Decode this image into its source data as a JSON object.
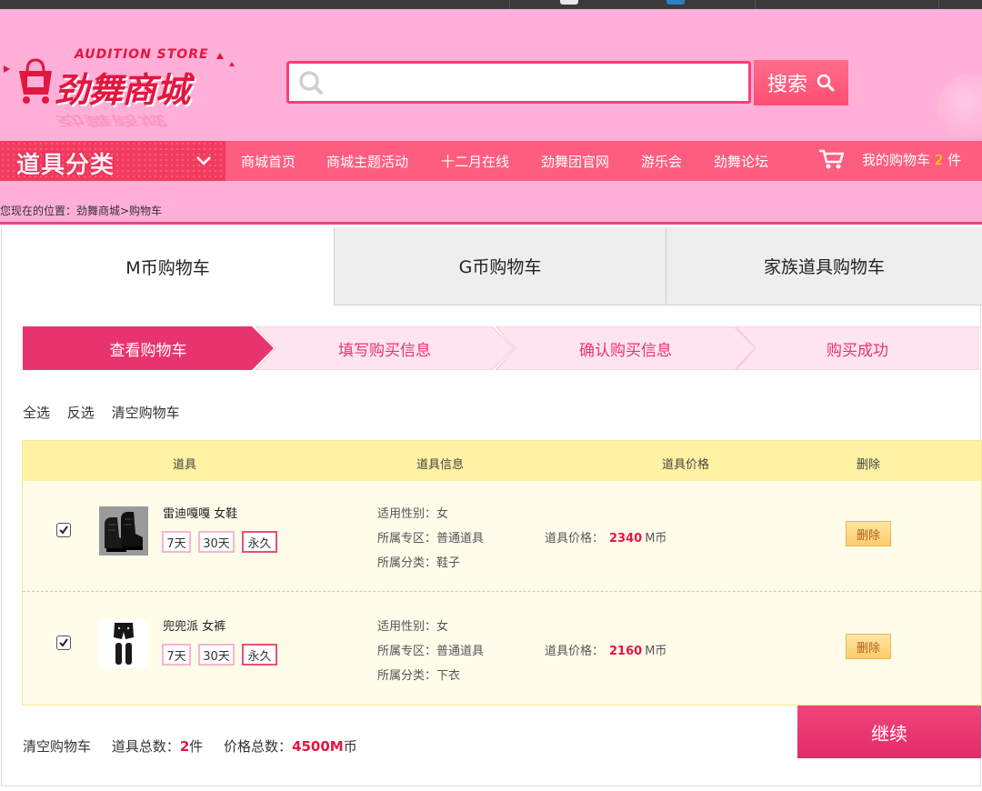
{
  "brand": {
    "logo_en": "AUDITION STORE",
    "logo_cn": "劲舞商城"
  },
  "search": {
    "value": "",
    "placeholder": "",
    "button_label": "搜索"
  },
  "nav": {
    "category_label": "道具分类",
    "items": [
      "商城首页",
      "商城主题活动",
      "十二月在线",
      "劲舞团官网",
      "游乐会",
      "劲舞论坛"
    ],
    "cart_label_prefix": "我的购物车",
    "cart_count": "2",
    "cart_label_suffix": "件"
  },
  "breadcrumb": "您现在的位置：劲舞商城>购物车",
  "tabs": [
    {
      "label": "M币购物车",
      "active": true
    },
    {
      "label": "G币购物车",
      "active": false
    },
    {
      "label": "家族道具购物车",
      "active": false
    }
  ],
  "steps": [
    "查看购物车",
    "填写购买信息",
    "确认购买信息",
    "购买成功"
  ],
  "selection": {
    "select_all": "全选",
    "invert": "反选",
    "clear": "清空购物车"
  },
  "table": {
    "headers": [
      "道具",
      "道具信息",
      "道具价格",
      "删除"
    ],
    "items": [
      {
        "checked": true,
        "name": "雷迪嘎嘎 女鞋",
        "image_icon": "black-boots-icon",
        "durations": [
          "7天",
          "30天",
          "永久"
        ],
        "selected_duration": "永久",
        "gender": "适用性别：女",
        "zone": "所属专区：普通道具",
        "category": "所属分类：鞋子",
        "price_label": "道具价格：",
        "price": "2340",
        "currency": "M币",
        "delete_label": "删除"
      },
      {
        "checked": true,
        "name": "兜兜派 女裤",
        "image_icon": "black-shorts-icon",
        "durations": [
          "7天",
          "30天",
          "永久"
        ],
        "selected_duration": "永久",
        "gender": "适用性别：女",
        "zone": "所属专区：普通道具",
        "category": "所属分类：下衣",
        "price_label": "道具价格：",
        "price": "2160",
        "currency": "M币",
        "delete_label": "删除"
      }
    ]
  },
  "summary": {
    "clear_label": "清空购物车",
    "total_items_label": "道具总数：",
    "total_items": "2",
    "total_items_unit": "件",
    "total_price_label": "价格总数：",
    "total_price": "4500M",
    "total_price_unit": "币",
    "continue_label": "继续"
  },
  "colors": {
    "header_bg": "#ffafd8",
    "nav_bg": "#ff5d7f",
    "accent_red": "#e3163f",
    "step_active": "#e8346e",
    "table_header": "#fff2a3"
  }
}
